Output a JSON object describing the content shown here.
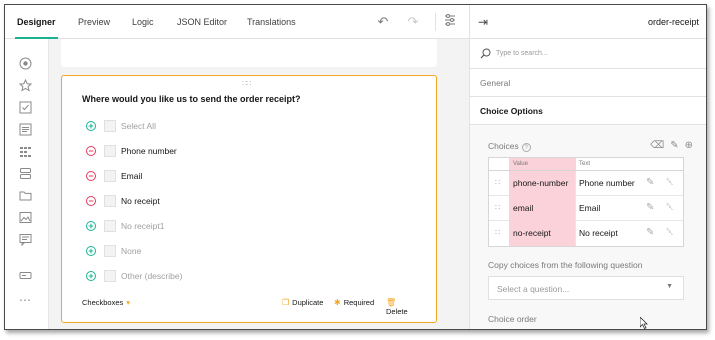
{
  "tabs": [
    "Designer",
    "Preview",
    "Logic",
    "JSON Editor",
    "Translations"
  ],
  "toolbar_icons": [
    "undo-icon",
    "redo-icon",
    "settings-icon"
  ],
  "toolbox_icons": [
    "radio-icon",
    "star-icon",
    "checkbox-icon",
    "text-icon",
    "grid-icon",
    "stack-icon",
    "folder-icon",
    "image-icon",
    "comment-icon",
    "input-icon",
    "more-icon"
  ],
  "question": {
    "title": "Where would you like us to send the order receipt?",
    "choices": [
      {
        "label": "Select All",
        "state": "add",
        "dim": true
      },
      {
        "label": "Phone number",
        "state": "remove",
        "dim": false
      },
      {
        "label": "Email",
        "state": "remove",
        "dim": false
      },
      {
        "label": "No receipt",
        "state": "remove",
        "dim": false
      },
      {
        "label": "No receipt1",
        "state": "add",
        "dim": true
      },
      {
        "label": "None",
        "state": "add",
        "dim": true
      },
      {
        "label": "Other (describe)",
        "state": "add",
        "dim": true
      }
    ],
    "type_label": "Checkboxes",
    "actions": {
      "duplicate": "Duplicate",
      "required": "Required",
      "delete": "Delete"
    }
  },
  "panel": {
    "title": "order-receipt",
    "search_placeholder": "Type to search...",
    "section_general": "General",
    "section_choice_options": "Choice Options",
    "choices_label": "Choices",
    "col_value": "Value",
    "col_text": "Text",
    "rows": [
      {
        "value": "phone-number",
        "text": "Phone number"
      },
      {
        "value": "email",
        "text": "Email"
      },
      {
        "value": "no-receipt",
        "text": "No receipt"
      }
    ],
    "copy_label": "Copy choices from the following question",
    "select_placeholder": "Select a question...",
    "order_label": "Choice order"
  },
  "colors": {
    "accent": "#19b394",
    "selection": "#f5a623",
    "remove": "#e23d5e",
    "value_bg": "#fbd1da"
  }
}
